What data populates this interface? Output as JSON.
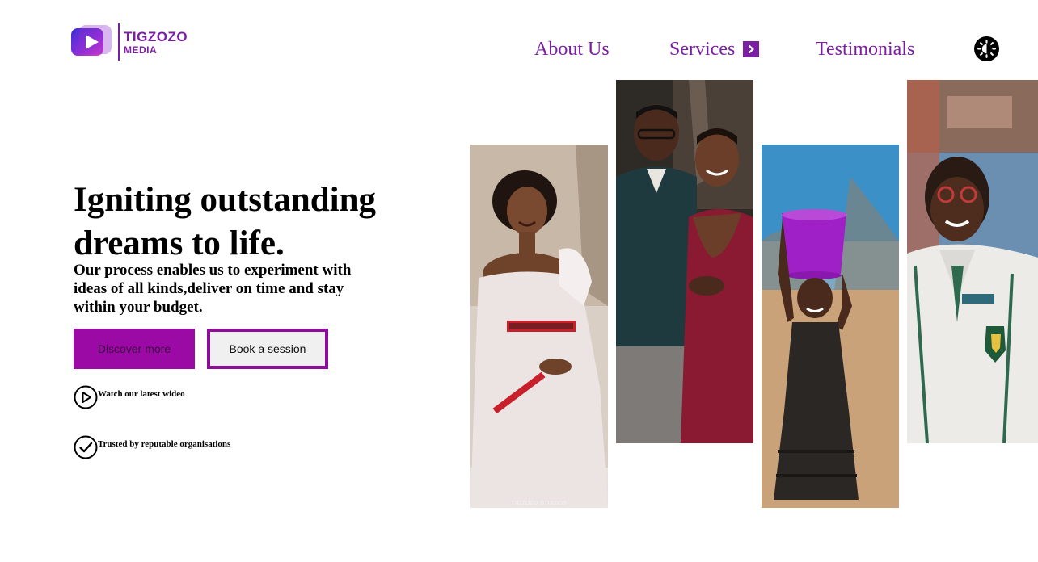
{
  "brand": {
    "name_line1": "TIGZOZO",
    "name_line2": "MEDIA",
    "icon": "play-logo-icon",
    "color": "#7b1fa2"
  },
  "nav": {
    "items": [
      {
        "label": "About Us"
      },
      {
        "label": "Services",
        "icon": "chevron-right-icon"
      },
      {
        "label": "Testimonials"
      }
    ],
    "theme_toggle_icon": "brightness-icon"
  },
  "hero": {
    "title": "Igniting outstanding dreams to life.",
    "subtitle": "Our process enables us to experiment with ideas of all kinds,deliver on time and stay within your budget.",
    "primary_button": "Discover more",
    "secondary_button": "Book a session",
    "features": [
      {
        "label": "Watch our latest wideo",
        "icon": "play-circle-icon"
      },
      {
        "label": "Trusted by reputable organisations",
        "icon": "check-circle-icon"
      }
    ]
  },
  "gallery": {
    "photos": [
      {
        "subject": "bride-in-white-dress",
        "watermark": "TIGZOZO STUDIOS"
      },
      {
        "subject": "couple-portrait"
      },
      {
        "subject": "girl-carrying-bucket"
      },
      {
        "subject": "student-in-blazer"
      }
    ]
  },
  "colors": {
    "accent": "#7b1fa2",
    "button_primary": "#9c0aa6",
    "button_secondary_border": "#8e0b9c",
    "background": "#ffffff"
  }
}
